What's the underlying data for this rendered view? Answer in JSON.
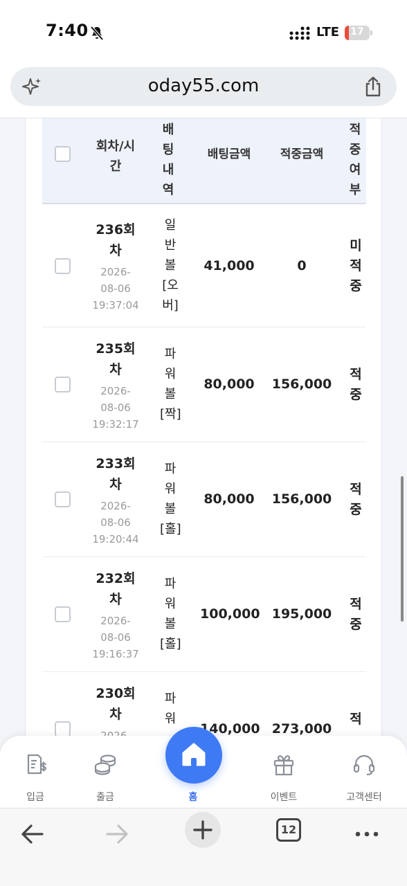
{
  "status_bar": {
    "time": "7:40",
    "network": "LTE",
    "battery": "17",
    "battery_level": 0.17
  },
  "browser": {
    "url": "oday55.com",
    "tab_count": "12"
  },
  "table": {
    "headers": {
      "round": "회차/시간",
      "bet_detail": "배팅내역",
      "bet_amount": "배팅금액",
      "win_amount": "적중금액",
      "result": "적중여부"
    },
    "rows": [
      {
        "round": "236회차",
        "date": "2026-08-06",
        "time": "19:37:04",
        "bet": "일반볼[오버]",
        "bet_amount": "41,000",
        "win_amount": "0",
        "result": "미적중"
      },
      {
        "round": "235회차",
        "date": "2026-08-06",
        "time": "19:32:17",
        "bet": "파워볼[짝]",
        "bet_amount": "80,000",
        "win_amount": "156,000",
        "result": "적중"
      },
      {
        "round": "233회차",
        "date": "2026-08-06",
        "time": "19:20:44",
        "bet": "파워볼[홀]",
        "bet_amount": "80,000",
        "win_amount": "156,000",
        "result": "적중"
      },
      {
        "round": "232회차",
        "date": "2026-08-06",
        "time": "19:16:37",
        "bet": "파워볼[홀]",
        "bet_amount": "100,000",
        "win_amount": "195,000",
        "result": "적중"
      },
      {
        "round": "230회차",
        "date": "2026-",
        "time": "",
        "bet": "파워",
        "bet_amount": "140,000",
        "win_amount": "273,000",
        "result": "적"
      }
    ]
  },
  "bottom_nav": {
    "deposit": "입금",
    "withdraw": "출금",
    "home": "홈",
    "event": "이벤트",
    "support": "고객센터"
  },
  "colors": {
    "accent": "#3f7af5",
    "header_bg": "#eef2fa",
    "battery_red": "#ea4a3d"
  }
}
